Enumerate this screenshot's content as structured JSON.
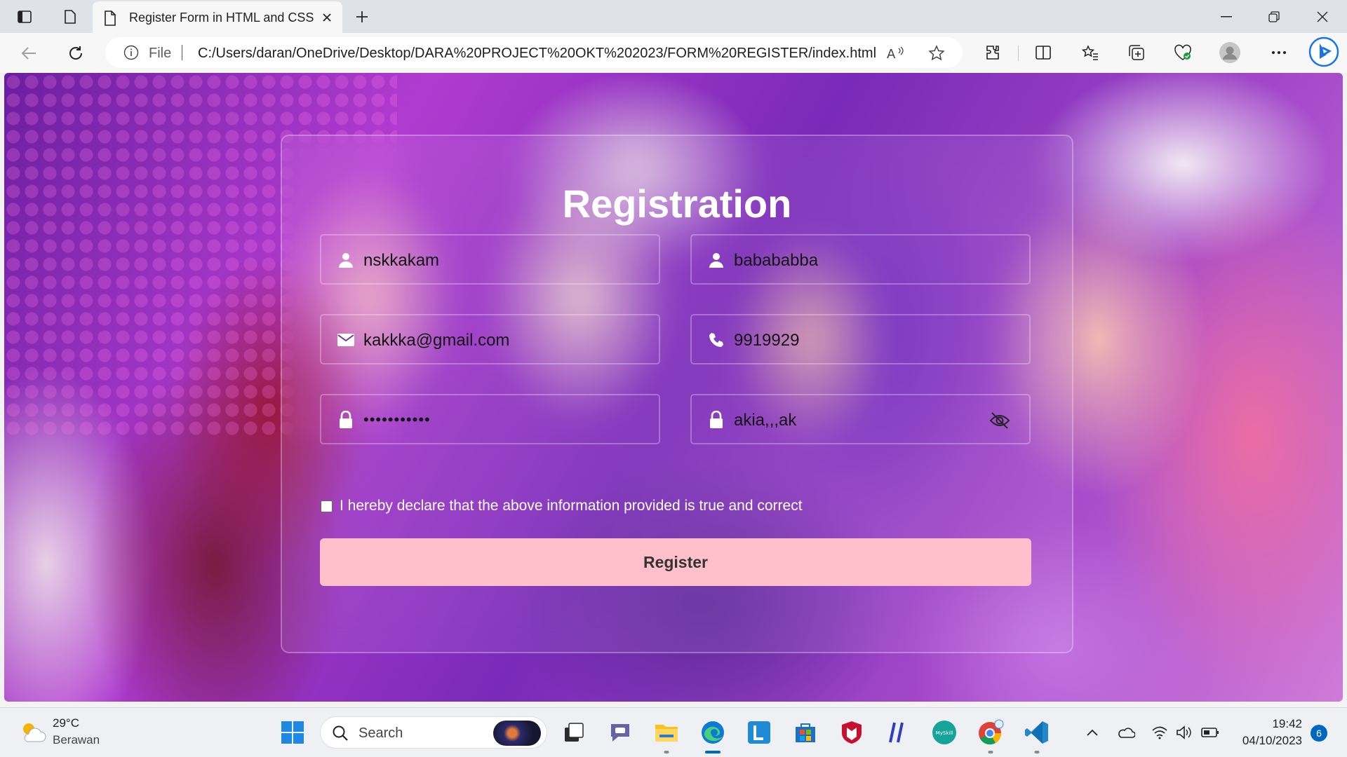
{
  "browser": {
    "tab_title": "Register Form in HTML and CSS",
    "address_scheme_label": "File",
    "address_url": "C:/Users/daran/OneDrive/Desktop/DARA%20PROJECT%20OKT%202023/FORM%20REGISTER/index.html"
  },
  "form": {
    "title": "Registration",
    "first_name_value": "nskkakam",
    "last_name_value": "babababba",
    "email_value": "kakkka@gmail.com",
    "phone_value": "9919929",
    "password_masked_value": "•••••••••••",
    "confirm_password_value": "akia,,,ak",
    "declaration_text": "I hereby declare that the above information provided is true and correct",
    "declaration_checked": false,
    "register_label": "Register",
    "button_color": "#ffc0cb"
  },
  "taskbar": {
    "weather_temp": "29°C",
    "weather_desc": "Berawan",
    "search_label": "Search",
    "clock_time": "19:42",
    "clock_date": "04/10/2023",
    "notification_count": "6"
  },
  "icons": {
    "first_name": "user-icon",
    "last_name": "user-icon",
    "email": "envelope-icon",
    "phone": "phone-icon",
    "password": "lock-icon",
    "confirm_password": "lock-icon",
    "visibility": "eye-off-icon"
  }
}
